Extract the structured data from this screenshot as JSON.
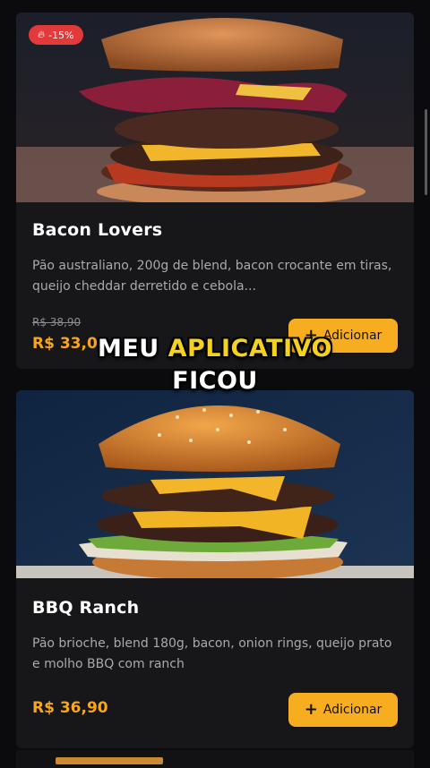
{
  "products": [
    {
      "badge": "-15%",
      "badge_icon": "flame-icon",
      "name": "Bacon Lovers",
      "description": "Pão australiano, 200g de blend, bacon crocante em tiras, queijo cheddar derretido e cebola...",
      "old_price": "R$ 38,90",
      "price": "R$ 33,0",
      "button_label": "Adicionar"
    },
    {
      "name": "BBQ Ranch",
      "description": "Pão brioche, blend 180g, bacon, onion rings, queijo prato e molho BBQ com ranch",
      "price": "R$ 36,90",
      "button_label": "Adicionar"
    }
  ],
  "caption": {
    "line1_white": "MEU",
    "line1_yellow": "APLICATIVO",
    "line2": "FICOU"
  },
  "colors": {
    "accent": "#f6ad1f",
    "price": "#f6a722",
    "badge": "#e23a3a",
    "caption_highlight": "#f4d21e"
  }
}
